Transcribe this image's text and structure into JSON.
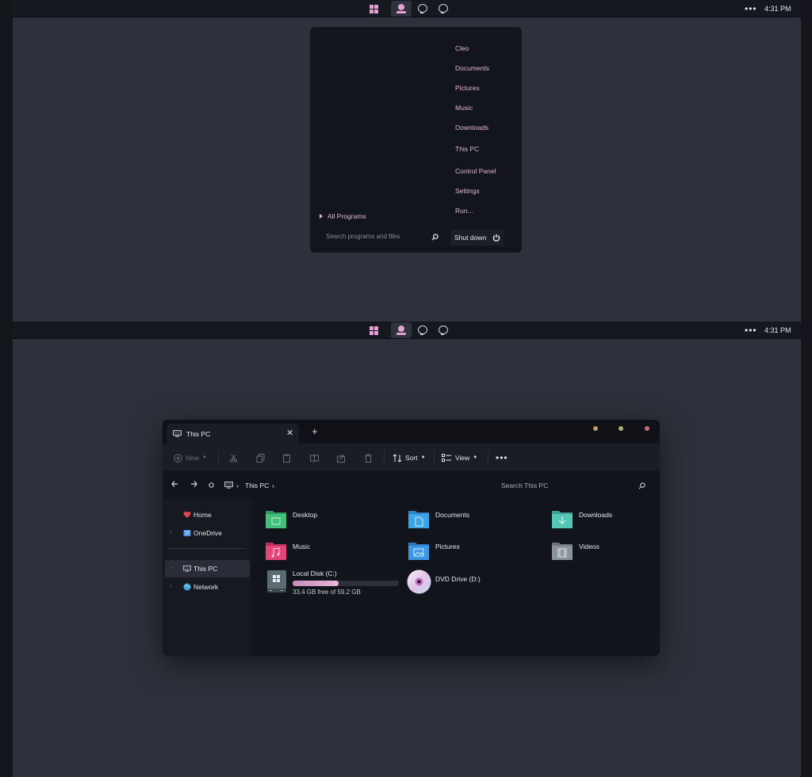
{
  "taskbar": {
    "more_label": "•••",
    "clock": "4:31 PM"
  },
  "start_menu": {
    "places": [
      "Cleo",
      "Documents",
      "Pictures",
      "Music",
      "Downloads",
      "This PC",
      "Control Panel",
      "Settings",
      "Run..."
    ],
    "all_programs": "All Programs",
    "search_placeholder": "Search programs and files",
    "shutdown": "Shut down"
  },
  "explorer": {
    "tab_title": "This PC",
    "new_tab_label": "+",
    "close_label": "✕",
    "window_dots": {
      "minimize": "#b9a06a",
      "maximize": "#a5b46f",
      "close": "#c66b78"
    },
    "toolbar": {
      "new": "New",
      "sort": "Sort",
      "view": "View"
    },
    "breadcrumb": [
      "This PC"
    ],
    "search_placeholder": "Search This PC",
    "sidebar": {
      "home": "Home",
      "onedrive": "OneDrive",
      "this_pc": "This PC",
      "network": "Network"
    },
    "folders": [
      {
        "name": "Desktop",
        "color": "#3fbf7a"
      },
      {
        "name": "Documents",
        "color": "#3aa6e8"
      },
      {
        "name": "Downloads",
        "color": "#55c6b8"
      },
      {
        "name": "Music",
        "color": "#e5457a"
      },
      {
        "name": "Pictures",
        "color": "#3b98e6"
      },
      {
        "name": "Videos",
        "color": "#8b939c"
      }
    ],
    "drives": [
      {
        "name": "Local Disk (C:)",
        "free": "33.4 GB free of 59.2 GB",
        "used_fraction": 0.436
      },
      {
        "name": "DVD Drive (D:)"
      }
    ]
  },
  "colors": {
    "accent": "#e1a4d2",
    "desktop": "#2e313b",
    "panel": "#13151c"
  }
}
